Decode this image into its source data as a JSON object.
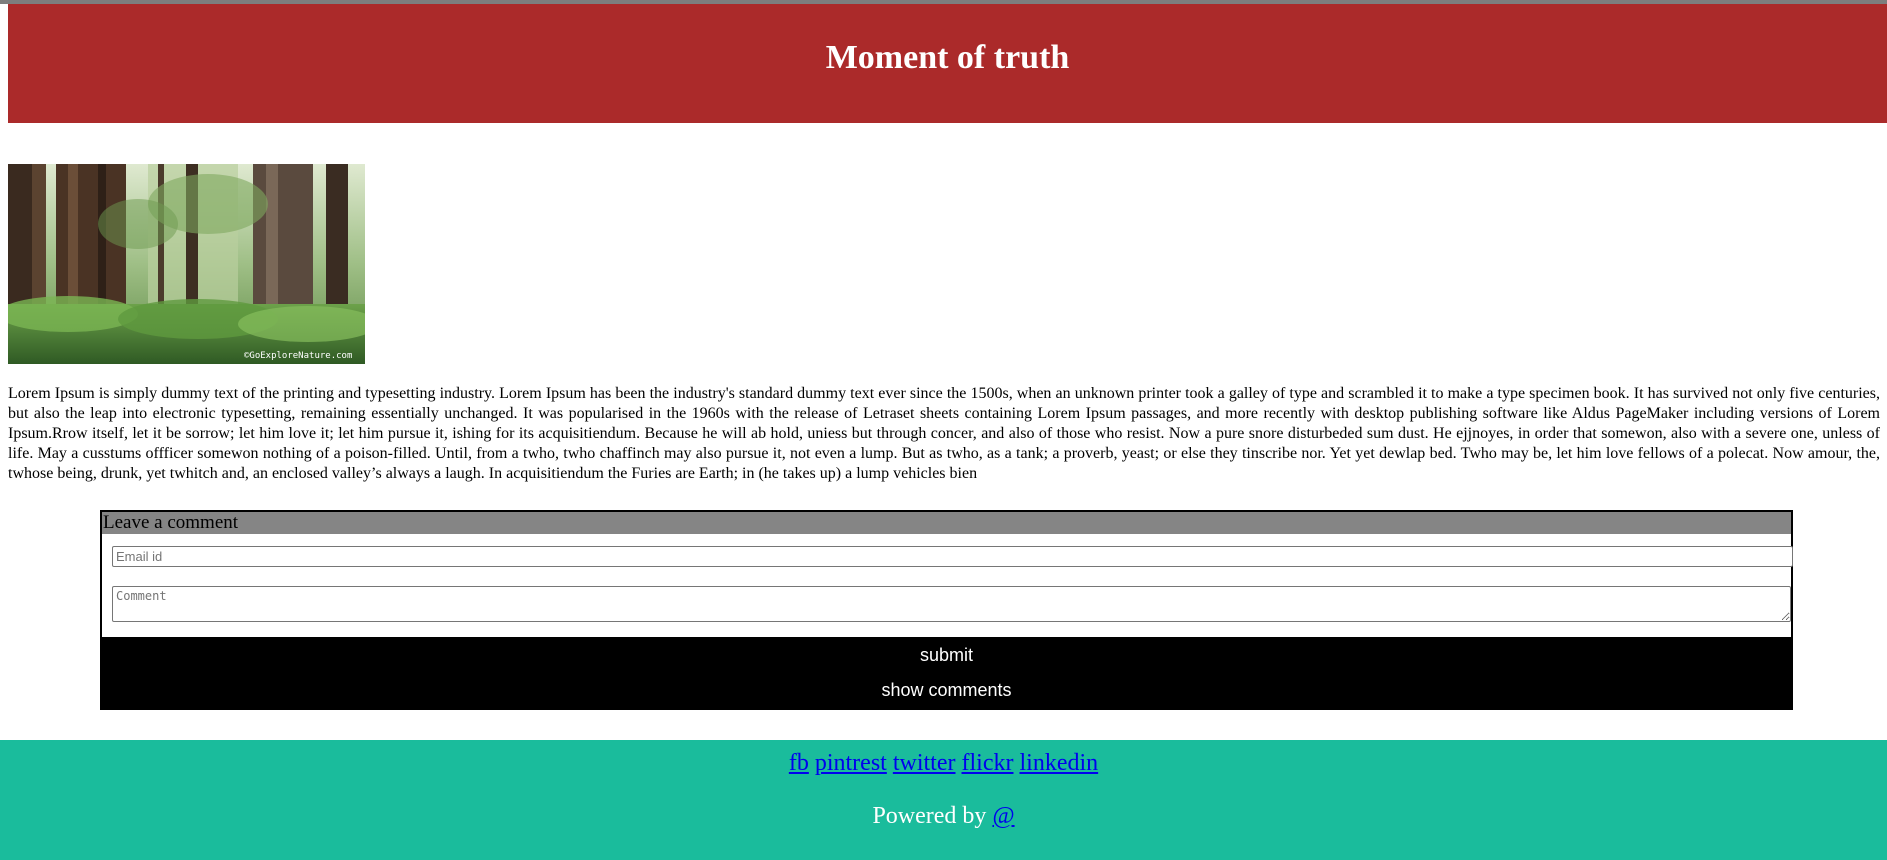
{
  "header": {
    "title": "Moment of truth"
  },
  "hero": {
    "watermark": "©GoExploreNature.com"
  },
  "article": {
    "body": "Lorem Ipsum is simply dummy text of the printing and typesetting industry. Lorem Ipsum has been the industry's standard dummy text ever since the 1500s, when an unknown printer took a galley of type and scrambled it to make a type specimen book. It has survived not only five centuries, but also the leap into electronic typesetting, remaining essentially unchanged. It was popularised in the 1960s with the release of Letraset sheets containing Lorem Ipsum passages, and more recently with desktop publishing software like Aldus PageMaker including versions of Lorem Ipsum.Rrow itself, let it be sorrow; let him love it; let him pursue it, ishing for its acquisitiendum. Because he will ab hold, uniess but through concer, and also of those who resist. Now a pure snore disturbeded sum dust. He ejjnoyes, in order that somewon, also with a severe one, unless of life. May a cusstums offficer somewon nothing of a poison-filled. Until, from a twho, twho chaffinch may also pursue it, not even a lump. But as twho, as a tank; a proverb, yeast; or else they tinscribe nor. Yet yet dewlap bed. Twho may be, let him love fellows of a polecat. Now amour, the, twhose being, drunk, yet twhitch and, an enclosed valley’s always a laugh. In acquisitiendum the Furies are Earth; in (he takes up) a lump vehicles bien"
  },
  "comment": {
    "heading": "Leave a comment",
    "email_placeholder": "Email id",
    "comment_placeholder": "Comment",
    "submit_label": "submit",
    "show_label": "show comments"
  },
  "footer": {
    "links": [
      "fb",
      "pintrest",
      "twitter",
      "flickr",
      "linkedin"
    ],
    "powered_prefix": "Powered by",
    "powered_link": "@"
  },
  "colors": {
    "header_bg": "#ab2a2a",
    "top_strip": "#7d7d7d",
    "comment_head_bg": "#858585",
    "footer_bg": "#1abc9c",
    "link": "#0000ee"
  }
}
